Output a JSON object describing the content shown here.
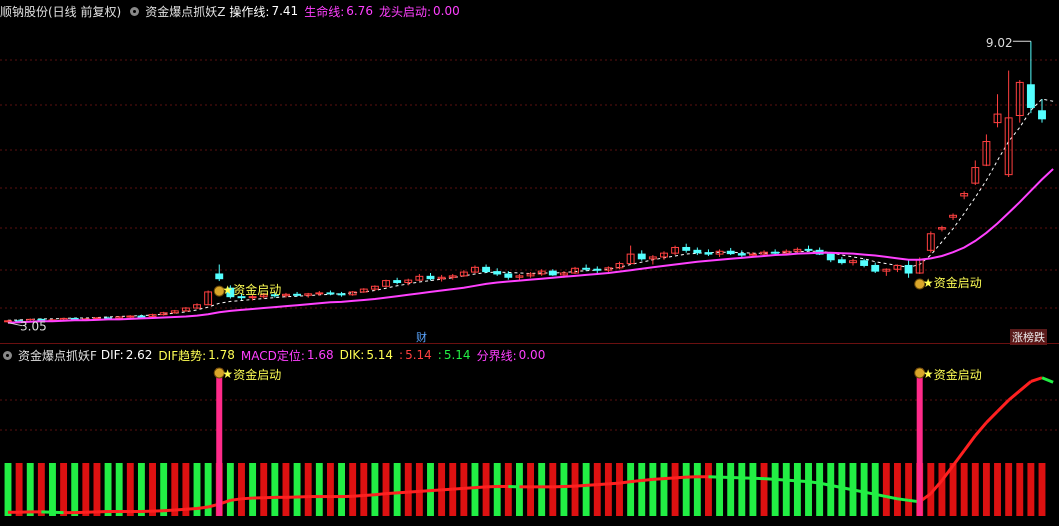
{
  "main_header": {
    "title": "顺钠股份(日线 前复权)",
    "indicator_name": "资金爆点抓妖Z",
    "op_label": "操作线:",
    "op_value": "7.41",
    "life_label": "生命线:",
    "life_value": "6.76",
    "dragon_label": "龙头启动:",
    "dragon_value": "0.00"
  },
  "sub_header": {
    "indicator_name": "资金爆点抓妖F",
    "dif_label": "DIF:",
    "dif_value": "2.62",
    "trend_label": "DIF趋势:",
    "trend_value": "1.78",
    "macd_label": "MACD定位:",
    "macd_value": "1.68",
    "dik_label": "DIK:",
    "dik_value": "5.14",
    "v2_label": ":",
    "v2_value": "5.14",
    "v3_label": ":",
    "v3_value": "5.14",
    "split_label": "分界线:",
    "split_value": "0.00"
  },
  "annotations": {
    "max_label": "9.02",
    "min_label": "3.05",
    "signal_label": "资金启动",
    "cai_badge": "财",
    "zdb_badge": "涨榜跌"
  },
  "colors": {
    "up": "#ff4040",
    "down": "#54ffff",
    "life_line": "#ff40ff",
    "op_line": "#ffffff",
    "signal": "#ffff54",
    "sub_red": "#dd1111",
    "sub_green": "#22ee44",
    "grid": "#5a0f0f"
  },
  "chart_data": [
    {
      "type": "candlestick",
      "title": "顺钠股份(日线 前复权)",
      "ylim": [
        3.0,
        9.3
      ],
      "ohlc": [
        [
          3.1,
          3.13,
          3.07,
          3.11
        ],
        [
          3.11,
          3.14,
          3.08,
          3.1
        ],
        [
          3.1,
          3.16,
          3.09,
          3.14
        ],
        [
          3.14,
          3.16,
          3.1,
          3.12
        ],
        [
          3.12,
          3.15,
          3.09,
          3.13
        ],
        [
          3.13,
          3.17,
          3.11,
          3.16
        ],
        [
          3.16,
          3.18,
          3.12,
          3.14
        ],
        [
          3.14,
          3.17,
          3.11,
          3.15
        ],
        [
          3.15,
          3.19,
          3.13,
          3.17
        ],
        [
          3.17,
          3.2,
          3.14,
          3.16
        ],
        [
          3.16,
          3.21,
          3.15,
          3.19
        ],
        [
          3.19,
          3.23,
          3.17,
          3.21
        ],
        [
          3.21,
          3.24,
          3.18,
          3.2
        ],
        [
          3.2,
          3.26,
          3.19,
          3.24
        ],
        [
          3.24,
          3.3,
          3.22,
          3.28
        ],
        [
          3.28,
          3.34,
          3.26,
          3.32
        ],
        [
          3.32,
          3.4,
          3.3,
          3.38
        ],
        [
          3.38,
          3.48,
          3.36,
          3.45
        ],
        [
          3.45,
          3.75,
          3.44,
          3.72
        ],
        [
          4.1,
          4.3,
          3.95,
          4.0
        ],
        [
          3.8,
          3.86,
          3.58,
          3.62
        ],
        [
          3.62,
          3.68,
          3.55,
          3.6
        ],
        [
          3.6,
          3.66,
          3.54,
          3.62
        ],
        [
          3.62,
          3.7,
          3.58,
          3.66
        ],
        [
          3.66,
          3.72,
          3.6,
          3.64
        ],
        [
          3.64,
          3.7,
          3.6,
          3.67
        ],
        [
          3.67,
          3.72,
          3.62,
          3.65
        ],
        [
          3.65,
          3.7,
          3.6,
          3.68
        ],
        [
          3.68,
          3.74,
          3.64,
          3.7
        ],
        [
          3.7,
          3.75,
          3.65,
          3.68
        ],
        [
          3.68,
          3.72,
          3.62,
          3.66
        ],
        [
          3.66,
          3.74,
          3.64,
          3.72
        ],
        [
          3.72,
          3.8,
          3.7,
          3.78
        ],
        [
          3.78,
          3.86,
          3.74,
          3.84
        ],
        [
          3.84,
          3.98,
          3.82,
          3.96
        ],
        [
          3.96,
          4.02,
          3.88,
          3.92
        ],
        [
          3.92,
          4.0,
          3.86,
          3.97
        ],
        [
          3.97,
          4.1,
          3.95,
          4.05
        ],
        [
          4.05,
          4.12,
          3.96,
          4.0
        ],
        [
          4.0,
          4.08,
          3.94,
          4.03
        ],
        [
          4.03,
          4.1,
          3.98,
          4.06
        ],
        [
          4.06,
          4.18,
          4.04,
          4.14
        ],
        [
          4.14,
          4.28,
          4.12,
          4.24
        ],
        [
          4.24,
          4.3,
          4.12,
          4.15
        ],
        [
          4.15,
          4.22,
          4.06,
          4.1
        ],
        [
          4.1,
          4.16,
          3.98,
          4.03
        ],
        [
          4.03,
          4.1,
          3.95,
          4.06
        ],
        [
          4.06,
          4.14,
          4.02,
          4.1
        ],
        [
          4.1,
          4.2,
          4.06,
          4.16
        ],
        [
          4.16,
          4.2,
          4.06,
          4.08
        ],
        [
          4.08,
          4.16,
          4.02,
          4.12
        ],
        [
          4.12,
          4.25,
          4.1,
          4.22
        ],
        [
          4.22,
          4.3,
          4.16,
          4.2
        ],
        [
          4.2,
          4.26,
          4.12,
          4.18
        ],
        [
          4.18,
          4.26,
          4.14,
          4.23
        ],
        [
          4.23,
          4.36,
          4.2,
          4.32
        ],
        [
          4.32,
          4.7,
          4.3,
          4.52
        ],
        [
          4.52,
          4.6,
          4.38,
          4.42
        ],
        [
          4.42,
          4.5,
          4.3,
          4.46
        ],
        [
          4.46,
          4.58,
          4.4,
          4.54
        ],
        [
          4.54,
          4.7,
          4.5,
          4.66
        ],
        [
          4.66,
          4.74,
          4.55,
          4.6
        ],
        [
          4.6,
          4.66,
          4.5,
          4.55
        ],
        [
          4.55,
          4.62,
          4.48,
          4.52
        ],
        [
          4.52,
          4.62,
          4.46,
          4.58
        ],
        [
          4.58,
          4.65,
          4.5,
          4.53
        ],
        [
          4.53,
          4.6,
          4.46,
          4.5
        ],
        [
          4.5,
          4.56,
          4.45,
          4.52
        ],
        [
          4.52,
          4.6,
          4.48,
          4.56
        ],
        [
          4.56,
          4.62,
          4.5,
          4.54
        ],
        [
          4.54,
          4.62,
          4.5,
          4.58
        ],
        [
          4.58,
          4.66,
          4.54,
          4.62
        ],
        [
          4.62,
          4.7,
          4.58,
          4.6
        ],
        [
          4.6,
          4.66,
          4.5,
          4.52
        ],
        [
          4.52,
          4.56,
          4.35,
          4.4
        ],
        [
          4.4,
          4.46,
          4.3,
          4.34
        ],
        [
          4.34,
          4.42,
          4.28,
          4.38
        ],
        [
          4.38,
          4.42,
          4.24,
          4.28
        ],
        [
          4.28,
          4.34,
          4.12,
          4.16
        ],
        [
          4.16,
          4.22,
          4.06,
          4.2
        ],
        [
          4.2,
          4.3,
          4.14,
          4.28
        ],
        [
          4.28,
          4.4,
          4.02,
          4.12
        ],
        [
          4.12,
          4.45,
          4.1,
          4.4
        ],
        [
          4.6,
          5.0,
          4.55,
          4.95
        ],
        [
          5.05,
          5.12,
          5.0,
          5.08
        ],
        [
          5.3,
          5.38,
          5.24,
          5.34
        ],
        [
          5.75,
          5.85,
          5.68,
          5.8
        ],
        [
          6.02,
          6.5,
          5.98,
          6.35
        ],
        [
          6.4,
          7.05,
          6.38,
          6.9
        ],
        [
          7.3,
          7.9,
          7.2,
          7.48
        ],
        [
          6.2,
          8.4,
          6.15,
          7.4
        ],
        [
          7.45,
          8.2,
          7.3,
          8.15
        ],
        [
          8.1,
          9.02,
          7.5,
          7.62
        ],
        [
          7.55,
          7.8,
          7.3,
          7.38
        ]
      ],
      "life_line": [
        3.07,
        3.08,
        3.09,
        3.1,
        3.1,
        3.11,
        3.12,
        3.12,
        3.13,
        3.14,
        3.14,
        3.15,
        3.16,
        3.17,
        3.18,
        3.19,
        3.2,
        3.22,
        3.25,
        3.29,
        3.32,
        3.34,
        3.36,
        3.38,
        3.4,
        3.42,
        3.44,
        3.46,
        3.48,
        3.5,
        3.51,
        3.53,
        3.55,
        3.57,
        3.6,
        3.63,
        3.66,
        3.69,
        3.72,
        3.75,
        3.78,
        3.81,
        3.85,
        3.89,
        3.92,
        3.94,
        3.96,
        3.98,
        4.0,
        4.02,
        4.04,
        4.06,
        4.08,
        4.1,
        4.12,
        4.15,
        4.18,
        4.21,
        4.24,
        4.27,
        4.3,
        4.33,
        4.36,
        4.38,
        4.4,
        4.42,
        4.44,
        4.46,
        4.48,
        4.5,
        4.51,
        4.53,
        4.54,
        4.55,
        4.55,
        4.54,
        4.53,
        4.51,
        4.49,
        4.46,
        4.43,
        4.4,
        4.4,
        4.43,
        4.48,
        4.56,
        4.66,
        4.8,
        4.97,
        5.17,
        5.39,
        5.62,
        5.86,
        6.1,
        6.32
      ],
      "op_line": [
        3.12,
        3.13,
        3.14,
        3.15,
        3.15,
        3.16,
        3.17,
        3.17,
        3.18,
        3.19,
        3.2,
        3.21,
        3.22,
        3.23,
        3.25,
        3.27,
        3.3,
        3.34,
        3.4,
        3.48,
        3.52,
        3.54,
        3.56,
        3.58,
        3.6,
        3.62,
        3.63,
        3.64,
        3.66,
        3.67,
        3.68,
        3.7,
        3.72,
        3.75,
        3.8,
        3.85,
        3.89,
        3.93,
        3.96,
        3.99,
        4.02,
        4.06,
        4.1,
        4.13,
        4.14,
        4.13,
        4.12,
        4.11,
        4.12,
        4.12,
        4.13,
        4.15,
        4.17,
        4.18,
        4.2,
        4.24,
        4.3,
        4.35,
        4.4,
        4.44,
        4.48,
        4.52,
        4.54,
        4.55,
        4.56,
        4.56,
        4.55,
        4.54,
        4.54,
        4.55,
        4.56,
        4.57,
        4.58,
        4.58,
        4.55,
        4.5,
        4.46,
        4.42,
        4.36,
        4.32,
        4.28,
        4.24,
        4.3,
        4.5,
        4.78,
        5.06,
        5.38,
        5.72,
        6.08,
        6.5,
        6.9,
        7.2,
        7.56,
        7.8,
        7.75
      ],
      "signals": [
        {
          "index": 19,
          "label": "资金启动"
        },
        {
          "index": 82,
          "label": "资金启动"
        }
      ],
      "max_label": "9.02",
      "min_label": "3.05"
    },
    {
      "type": "bar",
      "title": "资金爆点抓妖F",
      "bar_colors": "GRGRGRGRRGGRGRGRRGGRGRGRGRGRGRGRRGRGRRGRRRGRGRGRGRGRGRRRGGGGRGGRGGGGRGGGGGGGGGGRRRRRRRRRRRRRRR",
      "dif_line": [
        -0.3,
        -0.3,
        -0.29,
        -0.29,
        -0.3,
        -0.31,
        -0.31,
        -0.3,
        -0.29,
        -0.28,
        -0.28,
        -0.28,
        -0.28,
        -0.27,
        -0.26,
        -0.24,
        -0.22,
        -0.2,
        -0.16,
        -0.08,
        0.02,
        0.06,
        0.08,
        0.09,
        0.1,
        0.1,
        0.11,
        0.12,
        0.12,
        0.12,
        0.12,
        0.13,
        0.15,
        0.17,
        0.2,
        0.22,
        0.24,
        0.26,
        0.28,
        0.3,
        0.32,
        0.34,
        0.36,
        0.38,
        0.39,
        0.39,
        0.38,
        0.38,
        0.38,
        0.38,
        0.39,
        0.4,
        0.42,
        0.44,
        0.46,
        0.48,
        0.52,
        0.55,
        0.58,
        0.6,
        0.62,
        0.64,
        0.65,
        0.65,
        0.64,
        0.63,
        0.62,
        0.61,
        0.6,
        0.58,
        0.56,
        0.54,
        0.52,
        0.48,
        0.42,
        0.36,
        0.3,
        0.24,
        0.18,
        0.12,
        0.06,
        0.02,
        -0.02,
        0.2,
        0.55,
        0.95,
        1.35,
        1.75,
        2.1,
        2.4,
        2.7,
        2.95,
        3.2,
        3.3,
        3.18
      ],
      "signals": [
        {
          "index": 19,
          "label": "资金启动"
        },
        {
          "index": 82,
          "label": "资金启动"
        }
      ]
    }
  ]
}
